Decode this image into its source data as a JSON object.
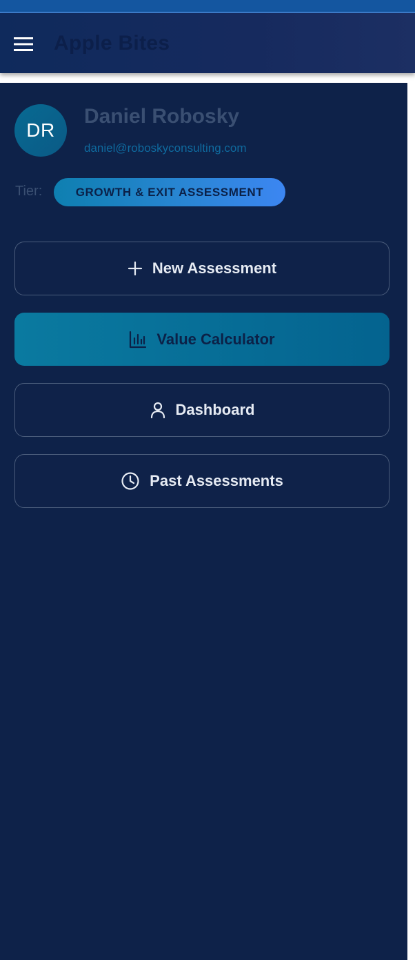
{
  "app": {
    "title": "Apple Bites"
  },
  "user": {
    "initials": "DR",
    "name": "Daniel Robosky",
    "email": "daniel@roboskyconsulting.com"
  },
  "tier": {
    "label": "Tier:",
    "value": "GROWTH & EXIT ASSESSMENT"
  },
  "nav": {
    "items": [
      {
        "label": "New Assessment",
        "icon": "plus-icon",
        "active": false
      },
      {
        "label": "Value Calculator",
        "icon": "bar-chart-icon",
        "active": true
      },
      {
        "label": "Dashboard",
        "icon": "user-icon",
        "active": false
      },
      {
        "label": "Past Assessments",
        "icon": "clock-icon",
        "active": false
      }
    ]
  },
  "colors": {
    "drawer_bg": "#0e2249",
    "accent": "#04638f",
    "badge_start": "#0e7fb0",
    "badge_end": "#3c86f2"
  }
}
